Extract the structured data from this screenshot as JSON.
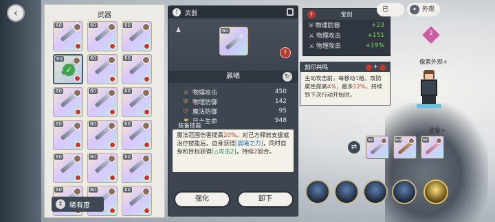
{
  "inventory": {
    "title": "武器",
    "rarity_label": "稀有度",
    "items": [
      {
        "level": "60",
        "selected": false
      },
      {
        "level": "60",
        "selected": false
      },
      {
        "level": "60",
        "selected": false
      },
      {
        "level": "60",
        "selected": true
      },
      {
        "level": "60",
        "selected": false
      },
      {
        "level": "60",
        "selected": false
      },
      {
        "level": "60",
        "selected": false
      },
      {
        "level": "60",
        "selected": false
      },
      {
        "level": "60",
        "selected": false
      },
      {
        "level": "60",
        "selected": false
      },
      {
        "level": "60",
        "selected": false
      },
      {
        "level": "60",
        "selected": false
      },
      {
        "level": "60",
        "selected": false
      },
      {
        "level": "60",
        "selected": false
      },
      {
        "level": "60",
        "selected": false
      },
      {
        "level": "60",
        "selected": false
      },
      {
        "level": "60",
        "selected": false
      },
      {
        "level": "60",
        "selected": false
      }
    ]
  },
  "detail": {
    "header": "武器",
    "weapon_level": "60",
    "name": "晨曦",
    "stats": [
      {
        "label": "物理攻击",
        "value": "450"
      },
      {
        "label": "物理防御",
        "value": "142"
      },
      {
        "label": "魔法防御",
        "value": "95"
      },
      {
        "label": "最大生命",
        "value": "948"
      }
    ],
    "skill_title": "装备技能",
    "skill_text_parts": {
      "p1": "魔法范围伤害提高",
      "pct": "20%",
      "p2": "。对己方释放支援或治疗技能后，自身获得",
      "buff1": "[晨曦之力]",
      "p3": "，同时自身和目标获得",
      "buff2": "[△攻击2]",
      "p4": "，持续",
      "dur": "2",
      "p5": "回合。"
    },
    "enhance_label": "强化",
    "unequip_label": "卸下"
  },
  "right_stats": {
    "title": "宝剑",
    "rows": [
      {
        "label": "物理防御",
        "value": "+23"
      },
      {
        "label": "物理攻击",
        "value": "+151"
      },
      {
        "label": "物理攻击",
        "value": "+19%"
      }
    ]
  },
  "seal": {
    "title": "刻印共鸣",
    "plus": "+",
    "text_parts": {
      "p1": "主动攻击前，每移动",
      "n1": "1",
      "p2": "格，攻防属性提高",
      "n2": "4%",
      "p3": "，最多",
      "n3": "12%",
      "p4": "，持续到下次行动开始时。"
    }
  },
  "top_tabs": {
    "tab_appearance": "外观",
    "tab_prev": "已"
  },
  "side": {
    "appearance_gem_num": "2",
    "pixel_appearance_label": "像素外观+",
    "equip_label": "装备+",
    "equip_level": "60"
  }
}
